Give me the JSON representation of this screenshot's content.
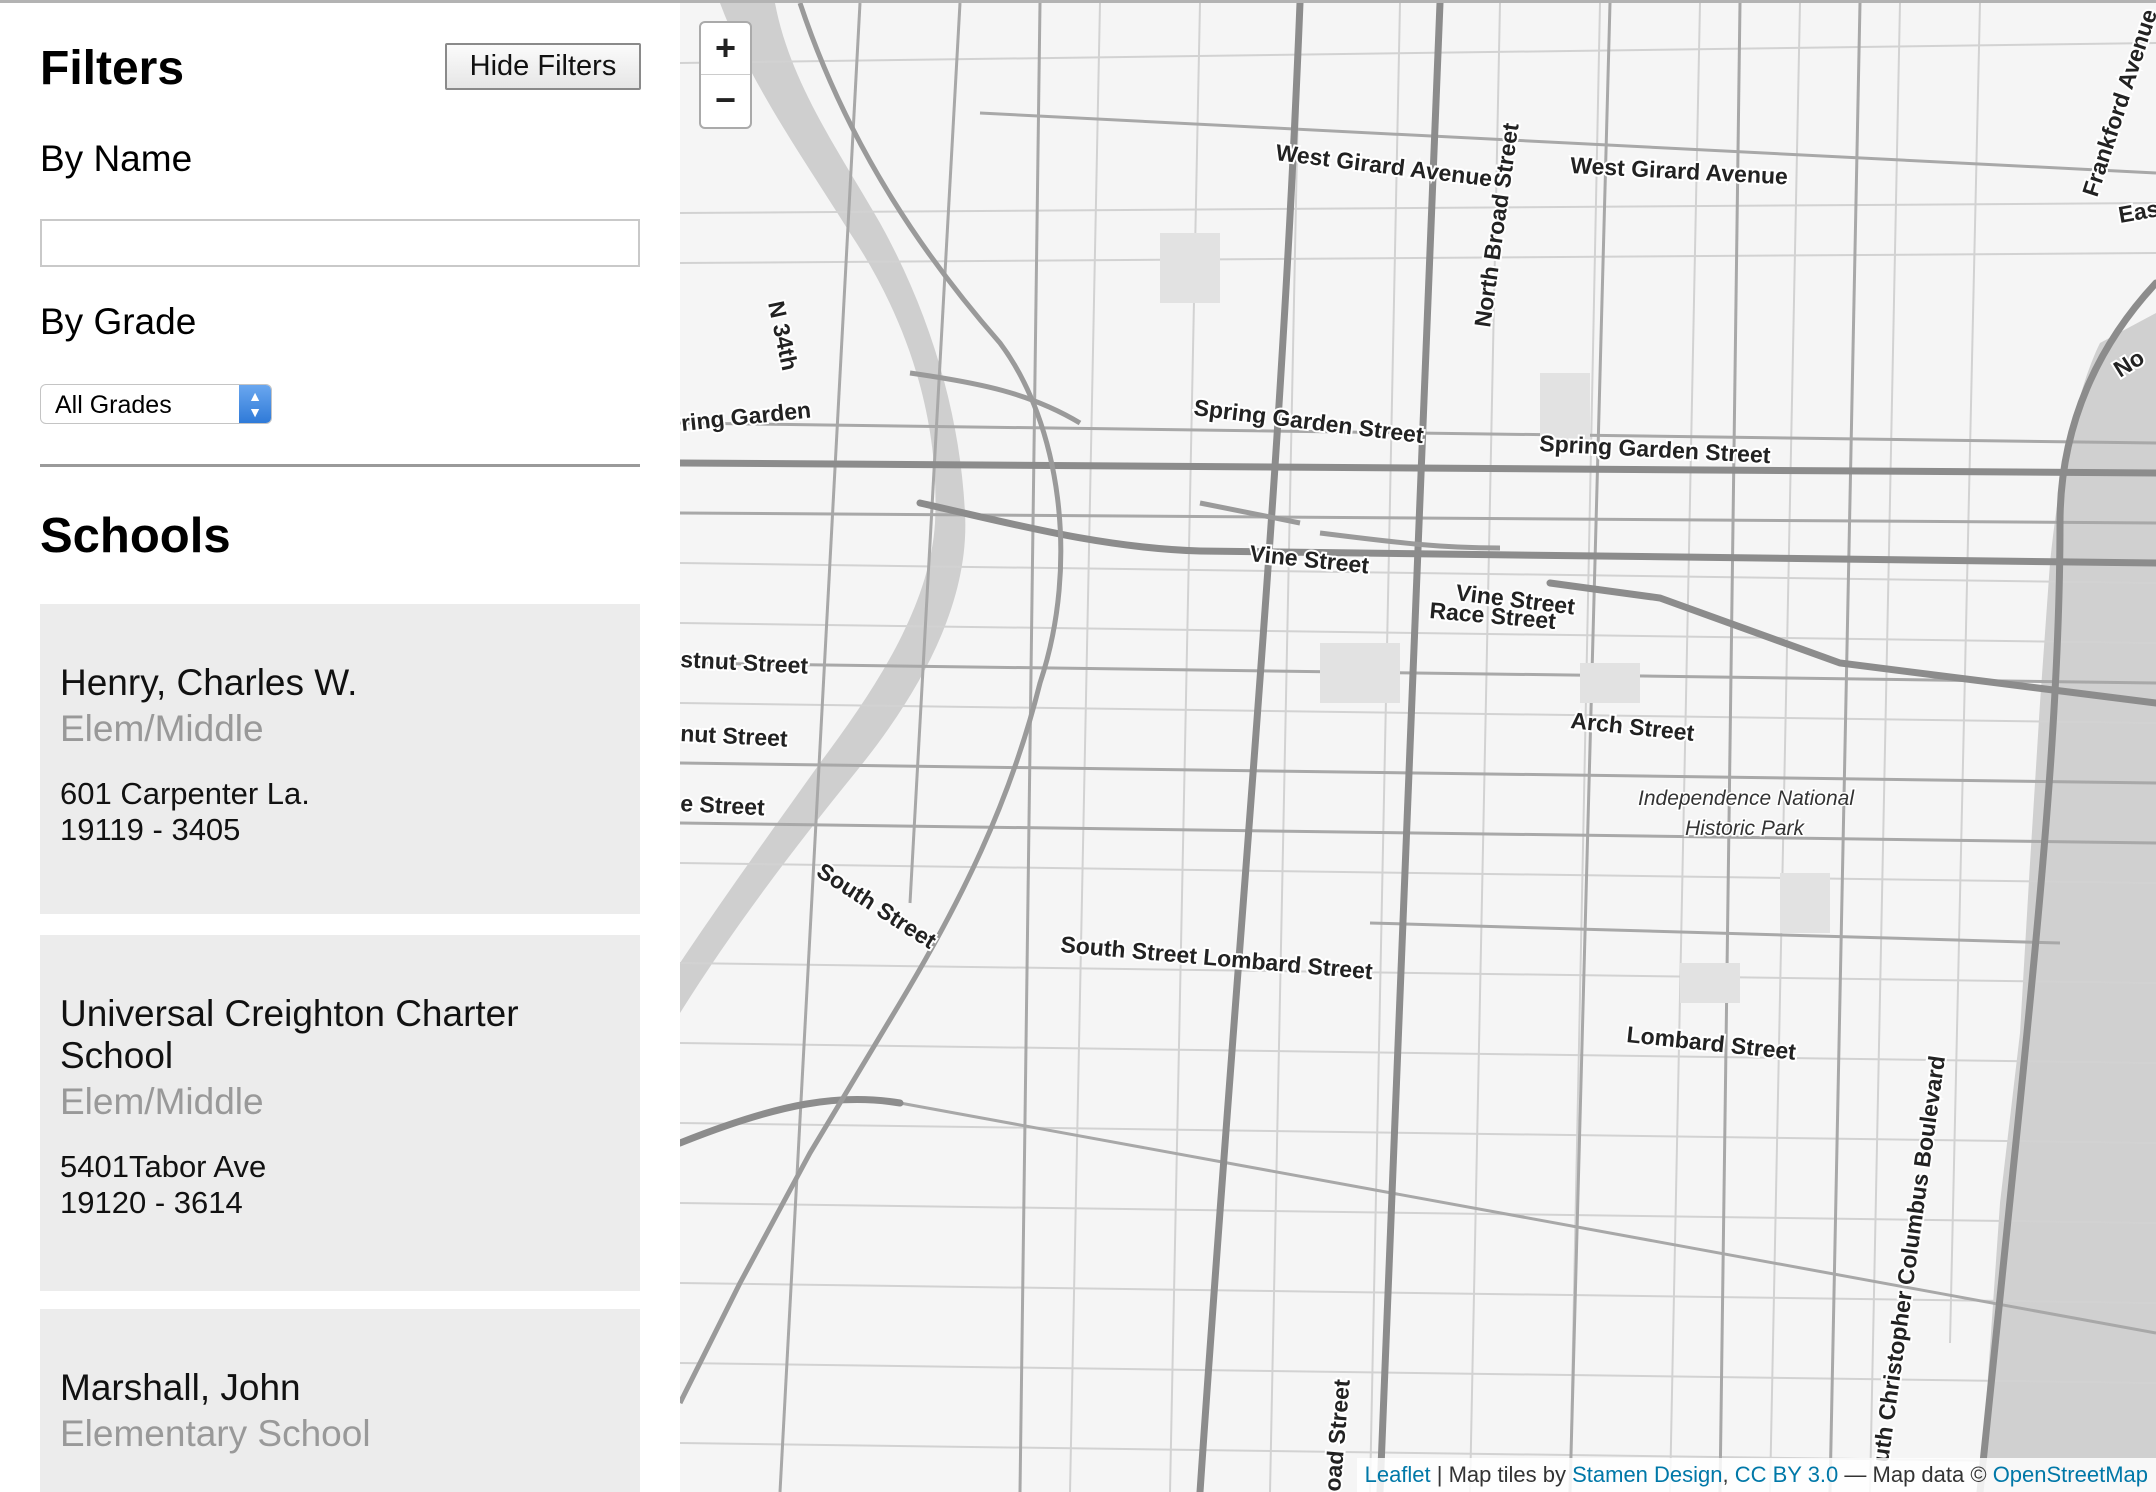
{
  "sidebar": {
    "filters_title": "Filters",
    "hide_filters_label": "Hide Filters",
    "by_name_label": "By Name",
    "name_input_value": "",
    "by_grade_label": "By Grade",
    "grade_selected": "All Grades",
    "schools_title": "Schools",
    "schools": [
      {
        "name": "Henry, Charles W.",
        "type": "Elem/Middle",
        "address": "601 Carpenter La.",
        "zip": "19119 - 3405"
      },
      {
        "name": "Universal Creighton Charter School",
        "type": "Elem/Middle",
        "address": "5401Tabor Ave",
        "zip": "19120 - 3614"
      },
      {
        "name": "Marshall, John",
        "type": "Elementary School"
      }
    ]
  },
  "map": {
    "zoom_in": "+",
    "zoom_out": "−",
    "streets": {
      "west_girard_1": "West Girard Avenue",
      "west_girard_2": "West Girard Avenue",
      "north_broad": "North Broad Street",
      "frankford": "Frankford Avenue",
      "eas": "Eas",
      "no": "No",
      "n34th": "N 34th",
      "spring_garden_w": "ring Garden",
      "spring_garden_1": "Spring Garden Street",
      "spring_garden_2": "Spring Garden Street",
      "vine_1": "Vine Street",
      "vine_2": "Vine Street",
      "race": "Race Street",
      "chestnut": "stnut Street",
      "walnut": "nut Street",
      "locust": "e Street",
      "arch": "Arch Street",
      "south_1": "South Street",
      "south_lombard": "South Street Lombard Street",
      "lombard": "Lombard Street",
      "columbus": "uth Christopher Columbus Boulevard",
      "broad_s": "oad Street"
    },
    "park_line1": "Independence National",
    "park_line2": "Historic Park",
    "attribution": {
      "leaflet": "Leaflet",
      "sep1": " | Map tiles by ",
      "stamen": "Stamen Design",
      "comma": ", ",
      "cc": "CC BY 3.0",
      "sep2": " — Map data © ",
      "osm": "OpenStreetMap"
    }
  }
}
